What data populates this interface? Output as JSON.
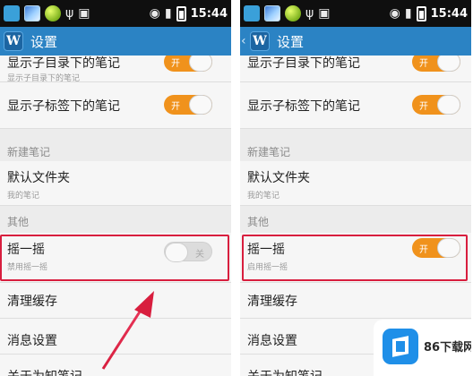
{
  "status_bar": {
    "time": "15:44",
    "icons": [
      "twitter-icon",
      "gallery-icon",
      "ball-app-icon",
      "usb-icon",
      "android-icon",
      "wifi-icon",
      "signal-icon",
      "battery-icon"
    ]
  },
  "action_bar": {
    "title": "设置"
  },
  "left_screen": {
    "items": [
      {
        "title": "显示子目录下的笔记",
        "subtitle": "显示子目录下的笔记",
        "toggle": "on",
        "toggle_label": "开"
      },
      {
        "title": "显示子标签下的笔记",
        "toggle": "on",
        "toggle_label": "开"
      }
    ],
    "section_new_note": "新建笔记",
    "default_folder": {
      "title": "默认文件夹",
      "subtitle": "我的笔记"
    },
    "section_other": "其他",
    "shake": {
      "title": "摇一摇",
      "subtitle": "禁用摇一摇",
      "toggle": "off",
      "toggle_label": "关"
    },
    "clear_cache": "清理缓存",
    "message_settings": "消息设置",
    "about": "关于为知笔记"
  },
  "right_screen": {
    "items": [
      {
        "title": "显示子目录下的笔记",
        "toggle": "on",
        "toggle_label": "开"
      },
      {
        "title": "显示子标签下的笔记",
        "toggle": "on",
        "toggle_label": "开"
      }
    ],
    "section_new_note": "新建笔记",
    "default_folder": {
      "title": "默认文件夹",
      "subtitle": "我的笔记"
    },
    "section_other": "其他",
    "shake": {
      "title": "摇一摇",
      "subtitle": "启用摇一摇",
      "toggle": "on",
      "toggle_label": "开"
    },
    "clear_cache": "清理缓存",
    "message_settings": "消息设置",
    "about": "关于为知笔记"
  },
  "watermark": {
    "text": "86下载网"
  },
  "colors": {
    "action_bar": "#2b83c4",
    "toggle_on": "#f0921c",
    "highlight": "#d81e3e",
    "status_bar": "#0f0f0f"
  }
}
